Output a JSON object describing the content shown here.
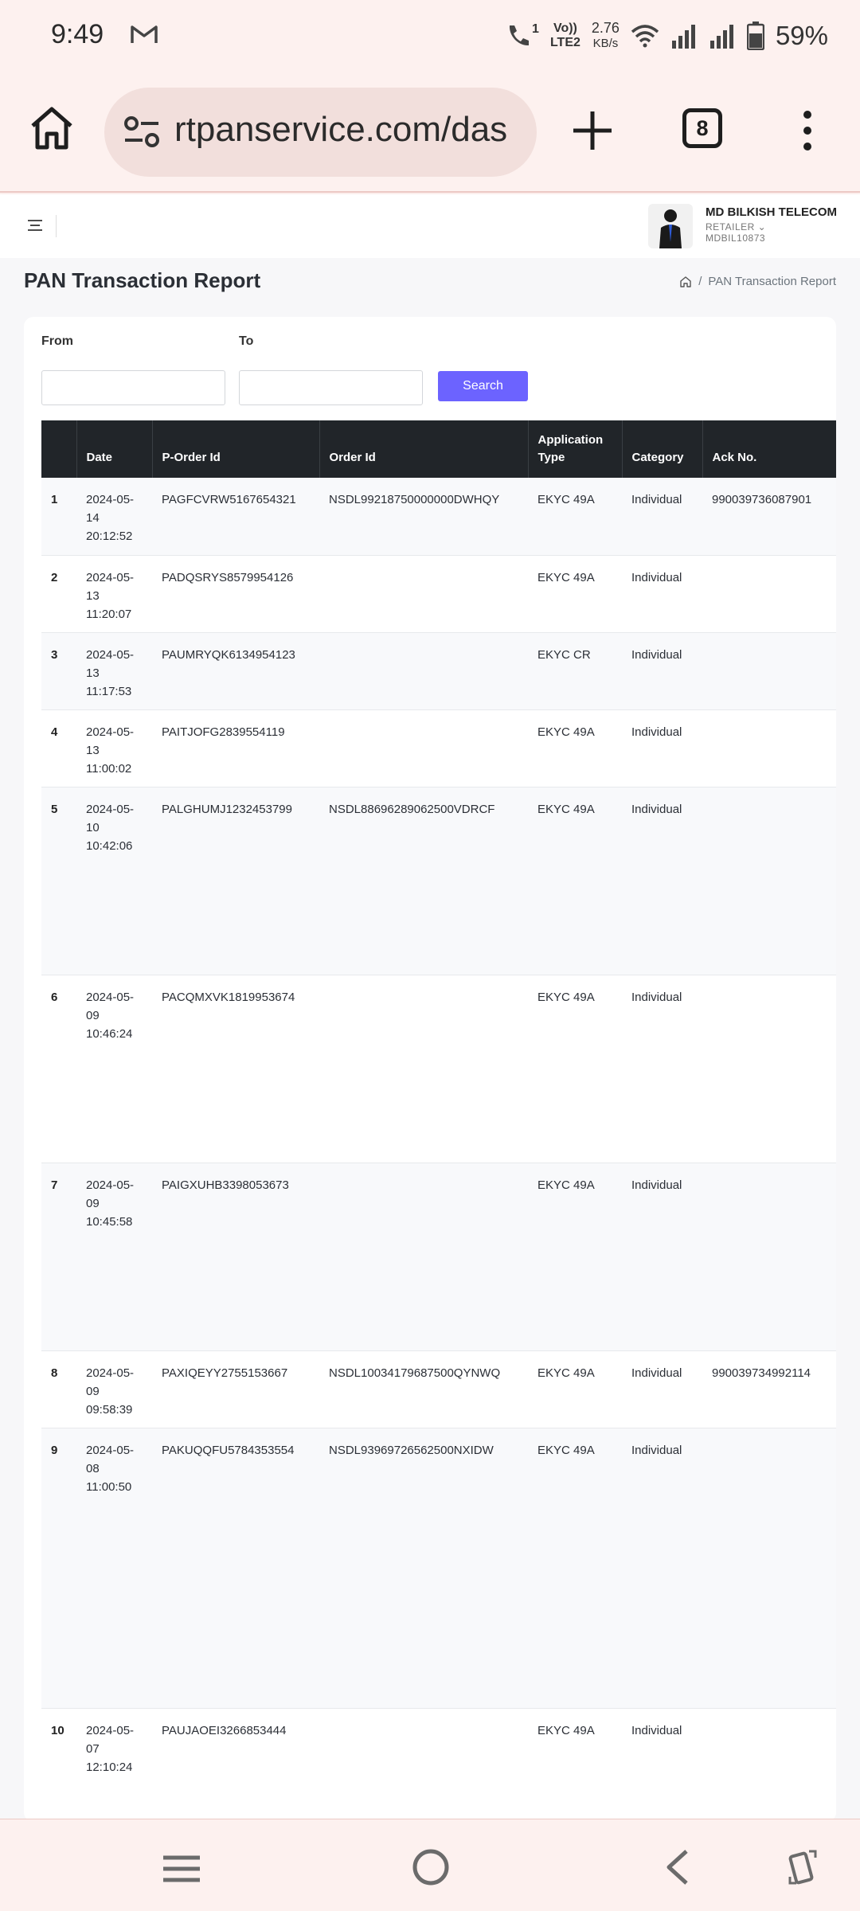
{
  "status_bar": {
    "time": "9:49",
    "call_indicator": "1",
    "network_top": "Vo))",
    "network_bottom": "LTE2",
    "speed_value": "2.76",
    "speed_unit": "KB/s",
    "battery": "59%"
  },
  "browser": {
    "url": "rtpanservice.com/das",
    "tab_count": "8"
  },
  "header": {
    "user_name": "MD BILKISH TELECOM",
    "user_role": "RETAILER",
    "user_id": "MDBIL10873"
  },
  "page": {
    "title": "PAN Transaction Report",
    "breadcrumb": "PAN Transaction Report"
  },
  "filters": {
    "from_label": "From",
    "to_label": "To",
    "from_value": "",
    "to_value": "",
    "search_label": "Search"
  },
  "table": {
    "headers": [
      "",
      "Date",
      "P-Order Id",
      "Order Id",
      "Application Type",
      "Category",
      "Ack No."
    ],
    "rows": [
      {
        "sn": "1",
        "date": "2024-05-14 20:12:52",
        "porder": "PAGFCVRW5167654321",
        "order": "NSDL99218750000000DWHQY",
        "type": "EKYC 49A",
        "category": "Individual",
        "ack": "990039736087901"
      },
      {
        "sn": "2",
        "date": "2024-05-13 11:20:07",
        "porder": "PADQSRYS8579954126",
        "order": "",
        "type": "EKYC 49A",
        "category": "Individual",
        "ack": ""
      },
      {
        "sn": "3",
        "date": "2024-05-13 11:17:53",
        "porder": "PAUMRYQK6134954123",
        "order": "",
        "type": "EKYC CR",
        "category": "Individual",
        "ack": ""
      },
      {
        "sn": "4",
        "date": "2024-05-13 11:00:02",
        "porder": "PAITJOFG2839554119",
        "order": "",
        "type": "EKYC 49A",
        "category": "Individual",
        "ack": ""
      },
      {
        "sn": "5",
        "date": "2024-05-10 10:42:06",
        "porder": "PALGHUMJ1232453799",
        "order": "NSDL88696289062500VDRCF",
        "type": "EKYC 49A",
        "category": "Individual",
        "ack": ""
      },
      {
        "sn": "6",
        "date": "2024-05-09 10:46:24",
        "porder": "PACQMXVK1819953674",
        "order": "",
        "type": "EKYC 49A",
        "category": "Individual",
        "ack": ""
      },
      {
        "sn": "7",
        "date": "2024-05-09 10:45:58",
        "porder": "PAIGXUHB3398053673",
        "order": "",
        "type": "EKYC 49A",
        "category": "Individual",
        "ack": ""
      },
      {
        "sn": "8",
        "date": "2024-05-09 09:58:39",
        "porder": "PAXIQEYY2755153667",
        "order": "NSDL10034179687500QYNWQ",
        "type": "EKYC 49A",
        "category": "Individual",
        "ack": "990039734992114"
      },
      {
        "sn": "9",
        "date": "2024-05-08 11:00:50",
        "porder": "PAKUQQFU5784353554",
        "order": "NSDL93969726562500NXIDW",
        "type": "EKYC 49A",
        "category": "Individual",
        "ack": ""
      },
      {
        "sn": "10",
        "date": "2024-05-07 12:10:24",
        "porder": "PAUJAOEI3266853444",
        "order": "",
        "type": "EKYC 49A",
        "category": "Individual",
        "ack": ""
      }
    ]
  }
}
